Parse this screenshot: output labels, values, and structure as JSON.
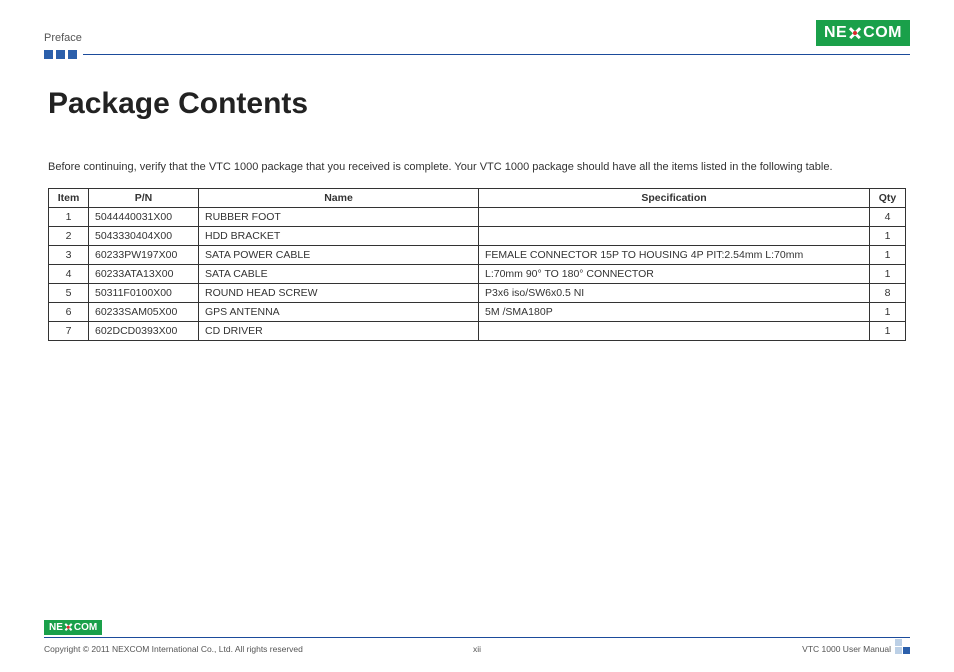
{
  "header": {
    "section": "Preface",
    "logo_text_left": "NE",
    "logo_text_right": "COM"
  },
  "page": {
    "title": "Package Contents",
    "intro": "Before continuing, verify that the VTC 1000 package that you received is complete. Your VTC 1000 package should have all the items listed in the following table."
  },
  "table": {
    "headers": {
      "item": "Item",
      "pn": "P/N",
      "name": "Name",
      "spec": "Specification",
      "qty": "Qty"
    },
    "rows": [
      {
        "item": "1",
        "pn": "5044440031X00",
        "name": "RUBBER FOOT",
        "spec": "",
        "qty": "4"
      },
      {
        "item": "2",
        "pn": "5043330404X00",
        "name": "HDD BRACKET",
        "spec": "",
        "qty": "1"
      },
      {
        "item": "3",
        "pn": "60233PW197X00",
        "name": "SATA POWER CABLE",
        "spec": "FEMALE CONNECTOR 15P TO HOUSING 4P PIT:2.54mm L:70mm",
        "qty": "1"
      },
      {
        "item": "4",
        "pn": "60233ATA13X00",
        "name": "SATA CABLE",
        "spec": "L:70mm 90° TO 180° CONNECTOR",
        "qty": "1"
      },
      {
        "item": "5",
        "pn": "50311F0100X00",
        "name": "ROUND HEAD SCREW",
        "spec": "P3x6 iso/SW6x0.5 NI",
        "qty": "8"
      },
      {
        "item": "6",
        "pn": "60233SAM05X00",
        "name": "GPS ANTENNA",
        "spec": "5M /SMA180P",
        "qty": "1"
      },
      {
        "item": "7",
        "pn": "602DCD0393X00",
        "name": "CD DRIVER",
        "spec": "",
        "qty": "1"
      }
    ]
  },
  "footer": {
    "logo_text_left": "NE",
    "logo_text_right": "COM",
    "copyright": "Copyright © 2011 NEXCOM International Co., Ltd. All rights reserved",
    "page_num": "xii",
    "doc_name": "VTC 1000 User Manual"
  }
}
